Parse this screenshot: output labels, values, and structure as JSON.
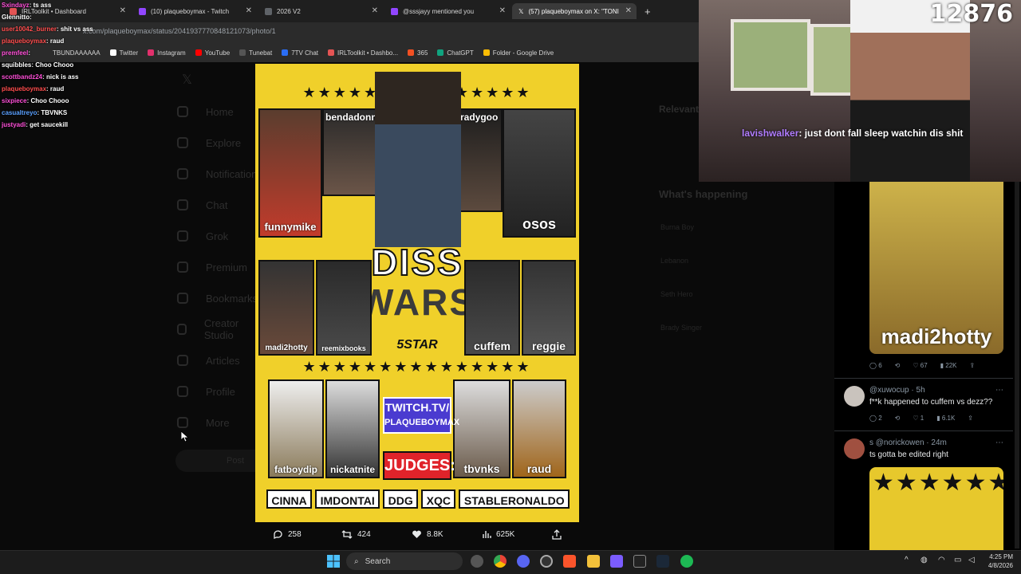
{
  "browser": {
    "tabs": [
      {
        "label": "IRLToolkit • Dashboard",
        "color": "#e45454"
      },
      {
        "label": "(10) plaqueboymax - Twitch",
        "color": "#9146ff"
      },
      {
        "label": "2026 V2",
        "color": "#5f6368"
      },
      {
        "label": "@sssjayy mentioned you",
        "color": "#9146ff"
      },
      {
        "label": "(57) plaqueboymax on X: \"TONI",
        "color": "#ffffff"
      }
    ],
    "new_tab": "+",
    "url": "x.com/plaqueboymax/status/2041937770848121073/photo/1",
    "bookmarks": [
      {
        "label": "TBUNDAAAAAA",
        "color": "#d93025"
      },
      {
        "label": "Twitter",
        "color": "#ffffff"
      },
      {
        "label": "Instagram",
        "color": "#e1306c"
      },
      {
        "label": "YouTube",
        "color": "#ff0000"
      },
      {
        "label": "Tunebat",
        "color": "#444444"
      },
      {
        "label": "7TV Chat",
        "color": "#2a6df4"
      },
      {
        "label": "IRLToolkit • Dashbo...",
        "color": "#e45454"
      },
      {
        "label": "365",
        "color": "#f25022"
      },
      {
        "label": "ChatGPT",
        "color": "#10a37f"
      },
      {
        "label": "Folder - Google Drive",
        "color": "#fbbc04"
      }
    ]
  },
  "x_sidebar": {
    "items": [
      "Home",
      "Explore",
      "Notifications",
      "Chat",
      "Grok",
      "Premium",
      "Bookmarks",
      "Creator Studio",
      "Articles",
      "Profile",
      "More"
    ],
    "post_button": "Post"
  },
  "right_column": {
    "relevant": "Relevant people",
    "happening": "What's happening",
    "trends": [
      "Burna Boy",
      "Lebanon",
      "Seth Hero",
      "Brady Singer"
    ]
  },
  "poster": {
    "title": "DISS",
    "subtitle": "WARS",
    "host": "5STAR",
    "twitch_line1": "TWITCH.TV/",
    "twitch_line2": "PLAQUEBOYMAX",
    "judges_label": "JUDGES:",
    "stars": "★★★★★★★★★★★★★★★",
    "top_names": [
      "bendadonnn",
      "bradygoo",
      "funnymike",
      "osos"
    ],
    "middle_names": [
      "madi2hotty",
      "reemixbooks",
      "cuffem",
      "reggie"
    ],
    "bottom_names": [
      "fatboydip",
      "nickatnite",
      "tbvnks",
      "raud"
    ],
    "judges": [
      "CINNA",
      "IMDONTAI",
      "DDG",
      "XQC",
      "STABLERONALDO"
    ]
  },
  "tweet_actions": {
    "replies": "258",
    "reposts": "424",
    "likes": "8.8K",
    "views": "625K"
  },
  "replies_column": {
    "reply1": {
      "image_text": "madi2hotty",
      "replies": "6",
      "likes": "67",
      "views": "22K"
    },
    "reply2": {
      "handle": "@xuwocup · 5h",
      "text": "f**k happened to cuffem vs dezz??",
      "replies": "2",
      "likes": "1",
      "views": "6.1K"
    },
    "reply3": {
      "handle": "s @norickowen · 24m",
      "text": "ts gotta be edited right"
    }
  },
  "stream_chat": [
    {
      "user": "Sxindayz",
      "msg": "ts ass",
      "color": "#ff4fd8"
    },
    {
      "user": "Glennitto",
      "msg": "",
      "color": "#ffffff"
    },
    {
      "user": "user10042_burner",
      "msg": "shit vs ass",
      "color": "#ff4d4d"
    },
    {
      "user": "plaqueboymax",
      "msg": "raud",
      "color": "#ff4d4d"
    },
    {
      "user": "premfeel",
      "msg": "",
      "color": "#ff4fd8"
    },
    {
      "user": "squibbles",
      "msg": "Choo Chooo",
      "color": "#ffffff"
    },
    {
      "user": "scottbandz24",
      "msg": "nick is ass",
      "color": "#ff4fd8"
    },
    {
      "user": "plaqueboymax",
      "msg": "raud",
      "color": "#ff4d4d"
    },
    {
      "user": "sixpiece",
      "msg": "Choo Chooo",
      "color": "#ff4fd8"
    },
    {
      "user": "casualtreyo",
      "msg": "TBVNKS",
      "color": "#5aa0ff"
    },
    {
      "user": "justyadi",
      "msg": "get saucekill",
      "color": "#ff4fd8"
    }
  ],
  "webcam": {
    "viewer_count": "12876",
    "chat_user": "lavishwalker",
    "chat_msg": ": just dont fall sleep watchin dis shit"
  },
  "taskbar": {
    "search": "Search",
    "time": "4:25 PM",
    "date": "4/8/2026"
  }
}
